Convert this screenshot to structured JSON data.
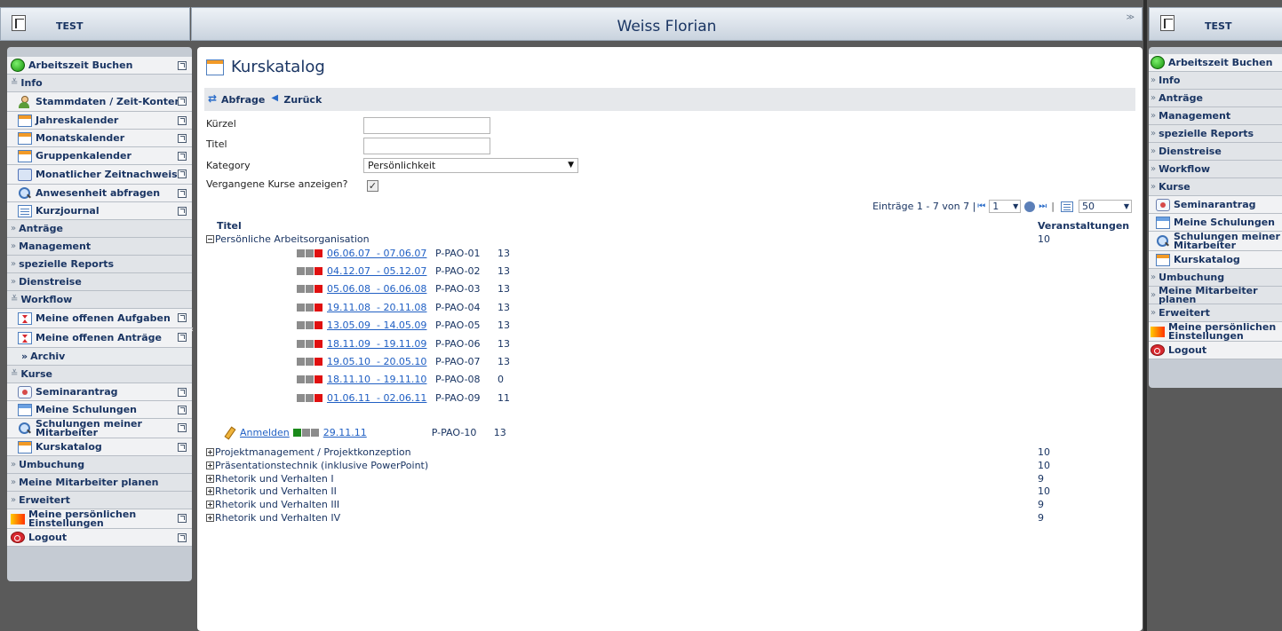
{
  "header": {
    "app_title_left": "TEST",
    "user_name": "Weiss Florian",
    "app_title_right": "TEST"
  },
  "sidebar": {
    "items": [
      {
        "type": "item",
        "label": "Arbeitszeit Buchen",
        "icon": "green-ball"
      },
      {
        "type": "section",
        "label": "Info",
        "state": "expanded"
      },
      {
        "type": "sub",
        "label": "Stammdaten / Zeit-Konten",
        "icon": "user"
      },
      {
        "type": "sub",
        "label": "Jahreskalender",
        "icon": "cal"
      },
      {
        "type": "sub",
        "label": "Monatskalender",
        "icon": "cal"
      },
      {
        "type": "sub",
        "label": "Gruppenkalender",
        "icon": "cal"
      },
      {
        "type": "sub",
        "label": "Monatlicher Zeitnachweis",
        "icon": "book"
      },
      {
        "type": "sub",
        "label": "Anwesenheit abfragen",
        "icon": "search"
      },
      {
        "type": "sub",
        "label": "Kurzjournal",
        "icon": "journal"
      },
      {
        "type": "section",
        "label": "Anträge",
        "state": "collapsed"
      },
      {
        "type": "section",
        "label": "Management",
        "state": "collapsed"
      },
      {
        "type": "section",
        "label": "spezielle Reports",
        "state": "collapsed"
      },
      {
        "type": "section",
        "label": "Dienstreise",
        "state": "collapsed"
      },
      {
        "type": "section",
        "label": "Workflow",
        "state": "expanded"
      },
      {
        "type": "sub",
        "label": "Meine offenen Aufgaben",
        "icon": "hourglass"
      },
      {
        "type": "sub",
        "label": "Meine offenen Anträge",
        "icon": "hourglass"
      },
      {
        "type": "subsub",
        "label": "Archiv"
      },
      {
        "type": "section",
        "label": "Kurse",
        "state": "expanded"
      },
      {
        "type": "sub",
        "label": "Seminarantrag",
        "icon": "seminar"
      },
      {
        "type": "sub",
        "label": "Meine Schulungen",
        "icon": "school"
      },
      {
        "type": "sub",
        "label": "Schulungen meiner Mitarbeiter",
        "icon": "search"
      },
      {
        "type": "sub",
        "label": "Kurskatalog",
        "icon": "cal"
      },
      {
        "type": "section",
        "label": "Umbuchung",
        "state": "collapsed"
      },
      {
        "type": "section",
        "label": "Meine Mitarbeiter planen",
        "state": "collapsed"
      },
      {
        "type": "section",
        "label": "Erweitert",
        "state": "collapsed"
      },
      {
        "type": "item",
        "label": "Meine persönlichen Einstellungen",
        "icon": "settings"
      },
      {
        "type": "item",
        "label": "Logout",
        "icon": "logout"
      }
    ]
  },
  "right_panel": {
    "items": [
      {
        "type": "item",
        "label": "Arbeitszeit Buchen",
        "icon": "green-ball"
      },
      {
        "type": "section",
        "label": "Info"
      },
      {
        "type": "section",
        "label": "Anträge"
      },
      {
        "type": "section",
        "label": "Management"
      },
      {
        "type": "section",
        "label": "spezielle Reports"
      },
      {
        "type": "section",
        "label": "Dienstreise"
      },
      {
        "type": "section",
        "label": "Workflow"
      },
      {
        "type": "section",
        "label": "Kurse"
      },
      {
        "type": "sub",
        "label": "Seminarantrag",
        "icon": "seminar"
      },
      {
        "type": "sub",
        "label": "Meine Schulungen",
        "icon": "school"
      },
      {
        "type": "sub",
        "label": "Schulungen meiner Mitarbeiter",
        "icon": "search"
      },
      {
        "type": "sub",
        "label": "Kurskatalog",
        "icon": "cal"
      },
      {
        "type": "section",
        "label": "Umbuchung"
      },
      {
        "type": "section",
        "label": "Meine Mitarbeiter planen"
      },
      {
        "type": "section",
        "label": "Erweitert"
      },
      {
        "type": "item",
        "label": "Meine persönlichen Einstellungen",
        "icon": "settings"
      },
      {
        "type": "item",
        "label": "Logout",
        "icon": "logout"
      }
    ]
  },
  "main": {
    "title": "Kurskatalog",
    "toolbar": {
      "query_label": "Abfrage",
      "back_label": "Zurück"
    },
    "form": {
      "kuerzel_label": "Kürzel",
      "kuerzel_value": "",
      "titel_label": "Titel",
      "titel_value": "",
      "kategory_label": "Kategory",
      "kategory_value": "Persönlichkeit",
      "past_label": "Vergangene Kurse anzeigen?",
      "past_checked": true
    },
    "pager": {
      "text": "Einträge 1 - 7 von 7 |",
      "page": "1",
      "page_size": "50"
    },
    "table": {
      "col_title": "Titel",
      "col_events": "Veranstaltungen",
      "expanded_course": {
        "name": "Persönliche Arbeitsorganisation",
        "count": "10"
      },
      "events": [
        {
          "date": "06.06.07  - 07.06.07",
          "code": "P-PAO-01",
          "num": "13"
        },
        {
          "date": "04.12.07  - 05.12.07",
          "code": "P-PAO-02",
          "num": "13"
        },
        {
          "date": "05.06.08  - 06.06.08",
          "code": "P-PAO-03",
          "num": "13"
        },
        {
          "date": "19.11.08  - 20.11.08",
          "code": "P-PAO-04",
          "num": "13"
        },
        {
          "date": "13.05.09  - 14.05.09",
          "code": "P-PAO-05",
          "num": "13"
        },
        {
          "date": "18.11.09  - 19.11.09",
          "code": "P-PAO-06",
          "num": "13"
        },
        {
          "date": "19.05.10  - 20.05.10",
          "code": "P-PAO-07",
          "num": "13"
        },
        {
          "date": "18.11.10  - 19.11.10",
          "code": "P-PAO-08",
          "num": "0"
        },
        {
          "date": "01.06.11  - 02.06.11",
          "code": "P-PAO-09",
          "num": "11"
        }
      ],
      "upcoming_event": {
        "register_label": "Anmelden",
        "date": "29.11.11",
        "code": "P-PAO-10",
        "num": "13"
      },
      "other_courses": [
        {
          "name": "Projektmanagement / Projektkonzeption",
          "count": "10"
        },
        {
          "name": "Präsentationstechnik (inklusive PowerPoint)",
          "count": "10"
        },
        {
          "name": "Rhetorik und Verhalten I",
          "count": "9"
        },
        {
          "name": "Rhetorik und Verhalten II",
          "count": "10"
        },
        {
          "name": "Rhetorik und Verhalten III",
          "count": "9"
        },
        {
          "name": "Rhetorik und Verhalten IV",
          "count": "9"
        }
      ]
    }
  },
  "colors": {
    "accent": "#1a3563",
    "link": "#2160c4",
    "past_block": "#e01010",
    "open_block": "#1a8a1a"
  }
}
